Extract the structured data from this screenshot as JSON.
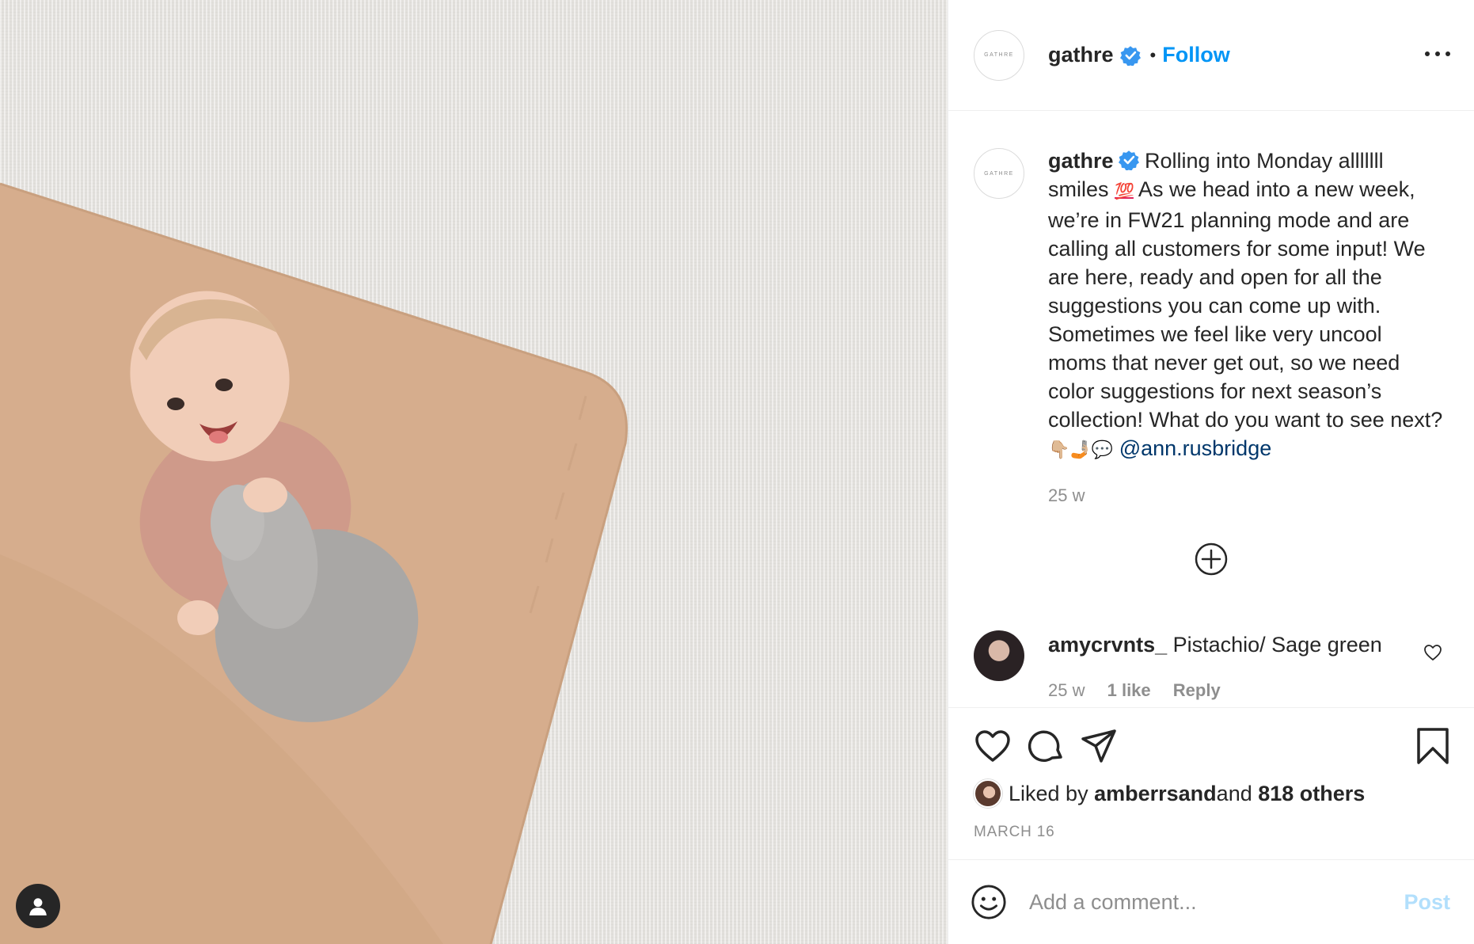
{
  "header": {
    "avatar_text": "GATHRE",
    "username": "gathre",
    "separator": "•",
    "follow_label": "Follow"
  },
  "caption": {
    "avatar_text": "GATHRE",
    "username": "gathre",
    "text_part1": " Rolling into Monday alllllll smiles ",
    "emoji_hundred": "💯",
    "text_part2": " As we head into a new week, we’re in FW21 planning mode and are calling all customers for some input! We are here, ready and open for all the suggestions you can come up with. Sometimes we feel like very uncool moms that never get out, so we need color suggestions for next season’s collection! What do you want to see next? ",
    "emoji_chain": "👇🏼🤳🏼💬",
    "mention": "@ann.rusbridge",
    "time": "25 w"
  },
  "comments": [
    {
      "username": "amycrvnts_",
      "text": " Pistachio/ Sage green",
      "time": "25 w",
      "likes": "1 like",
      "reply_label": "Reply"
    }
  ],
  "likes": {
    "prefix": "Liked by ",
    "user": "amberrsand",
    "middle": " and ",
    "others": "818 others"
  },
  "post_date": "MARCH 16",
  "comment_box": {
    "placeholder": "Add a comment...",
    "post_label": "Post"
  },
  "colors": {
    "accent": "#0095f6",
    "verified": "#3897f0",
    "mention": "#00376b",
    "post_disabled": "#b2dffc",
    "muted": "#8e8e8e"
  },
  "icons": {
    "verified": "verified-badge-icon",
    "more": "more-options-icon",
    "load_more": "load-more-comments-icon",
    "comment_like": "heart-icon",
    "like": "heart-icon",
    "comment": "comment-icon",
    "share": "share-icon",
    "save": "bookmark-icon",
    "emoji": "emoji-icon",
    "user_tag": "user-tag-icon"
  }
}
